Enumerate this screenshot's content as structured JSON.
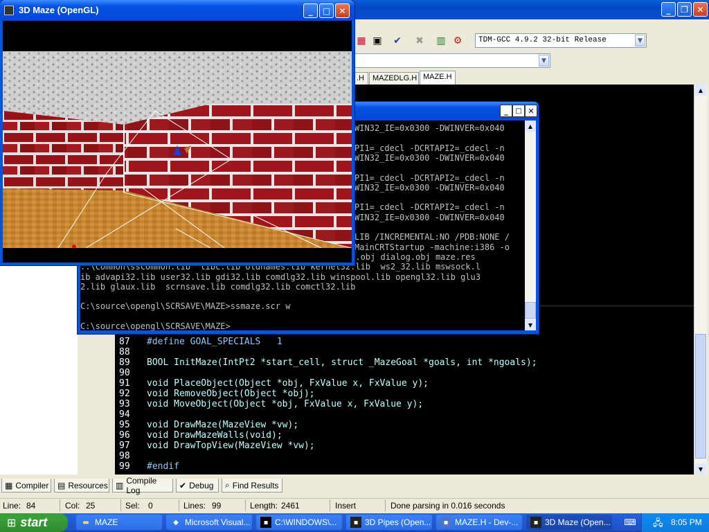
{
  "ide": {
    "compiler_profile": "TDM-GCC 4.9.2 32-bit Release",
    "file_tabs": [
      ".H",
      "MAZEDLG.H",
      "MAZE.H"
    ],
    "code_lines": [
      {
        "num": "87",
        "text": "#define GOAL_SPECIALS   1"
      },
      {
        "num": "88",
        "text": ""
      },
      {
        "num": "89",
        "text": "BOOL InitMaze(IntPt2 *start_cell, struct _MazeGoal *goals, int *ngoals);"
      },
      {
        "num": "90",
        "text": ""
      },
      {
        "num": "91",
        "text": "void PlaceObject(Object *obj, FxValue x, FxValue y);"
      },
      {
        "num": "92",
        "text": "void RemoveObject(Object *obj);"
      },
      {
        "num": "93",
        "text": "void MoveObject(Object *obj, FxValue x, FxValue y);"
      },
      {
        "num": "94",
        "text": ""
      },
      {
        "num": "95",
        "text": "void DrawMaze(MazeView *vw);"
      },
      {
        "num": "96",
        "text": "void DrawMazeWalls(void);"
      },
      {
        "num": "97",
        "text": "void DrawTopView(MazeView *vw);"
      },
      {
        "num": "98",
        "text": ""
      },
      {
        "num": "99",
        "text": "#endif"
      }
    ],
    "bottom_tabs": [
      "Compiler",
      "Resources",
      "Compile Log",
      "Debug",
      "Find Results"
    ],
    "status": {
      "line_label": "Line:",
      "line_value": "84",
      "col_label": "Col:",
      "col_value": "25",
      "sel_label": "Sel:",
      "sel_value": "0",
      "lines_label": "Lines:",
      "lines_value": "99",
      "length_label": "Length:",
      "length_value": "2461",
      "mode": "Insert",
      "message": "Done parsing in 0.016 seconds"
    }
  },
  "console": {
    "lines": [
      "WIN32_IE=0x0300 -DWINVER=0x040",
      "",
      "PI1=_cdecl -DCRTAPI2=_cdecl -n",
      "WIN32_IE=0x0300 -DWINVER=0x040",
      "",
      "PI1=_cdecl -DCRTAPI2=_cdecl -n",
      "WIN32_IE=0x0300 -DWINVER=0x040",
      "",
      "PI1=_cdecl -DCRTAPI2=_cdecl -n",
      "WIN32_IE=0x0300 -DWINVER=0x040",
      "",
      "LIB /INCREMENTAL:NO /PDB:NONE /",
      "MainCRTStartup -machine:i386 -o",
      "ut:ssmaze.scr genmaze.obj glmaze.obj ssmaze.obj slvmaze.obj dialog.obj maze.res",
      "..\\common\\sscommon.lib  libc.lib oldnames.lib kernel32.lib  ws2_32.lib mswsock.l",
      "ib advapi32.lib user32.lib gdi32.lib comdlg32.lib winspool.lib opengl32.lib glu3",
      "2.lib glaux.lib  scrnsave.lib comdlg32.lib comctl32.lib",
      "",
      "C:\\source\\opengl\\SCRSAVE\\MAZE>ssmaze.scr w",
      "",
      "C:\\source\\opengl\\SCRSAVE\\MAZE>"
    ]
  },
  "maze_window": {
    "title": "3D Maze (OpenGL)"
  },
  "taskbar": {
    "start_label": "start",
    "tasks": [
      "MAZE",
      "Microsoft Visual...",
      "C:\\WINDOWS\\...",
      "3D Pipes (Open...",
      "MAZE.H - Dev-...",
      "3D Maze (Open..."
    ],
    "clock": "8:05 PM"
  },
  "colors": {
    "brick": "#9b1a1f",
    "floor": "#c8862e",
    "title_blue": "#0552e3"
  }
}
